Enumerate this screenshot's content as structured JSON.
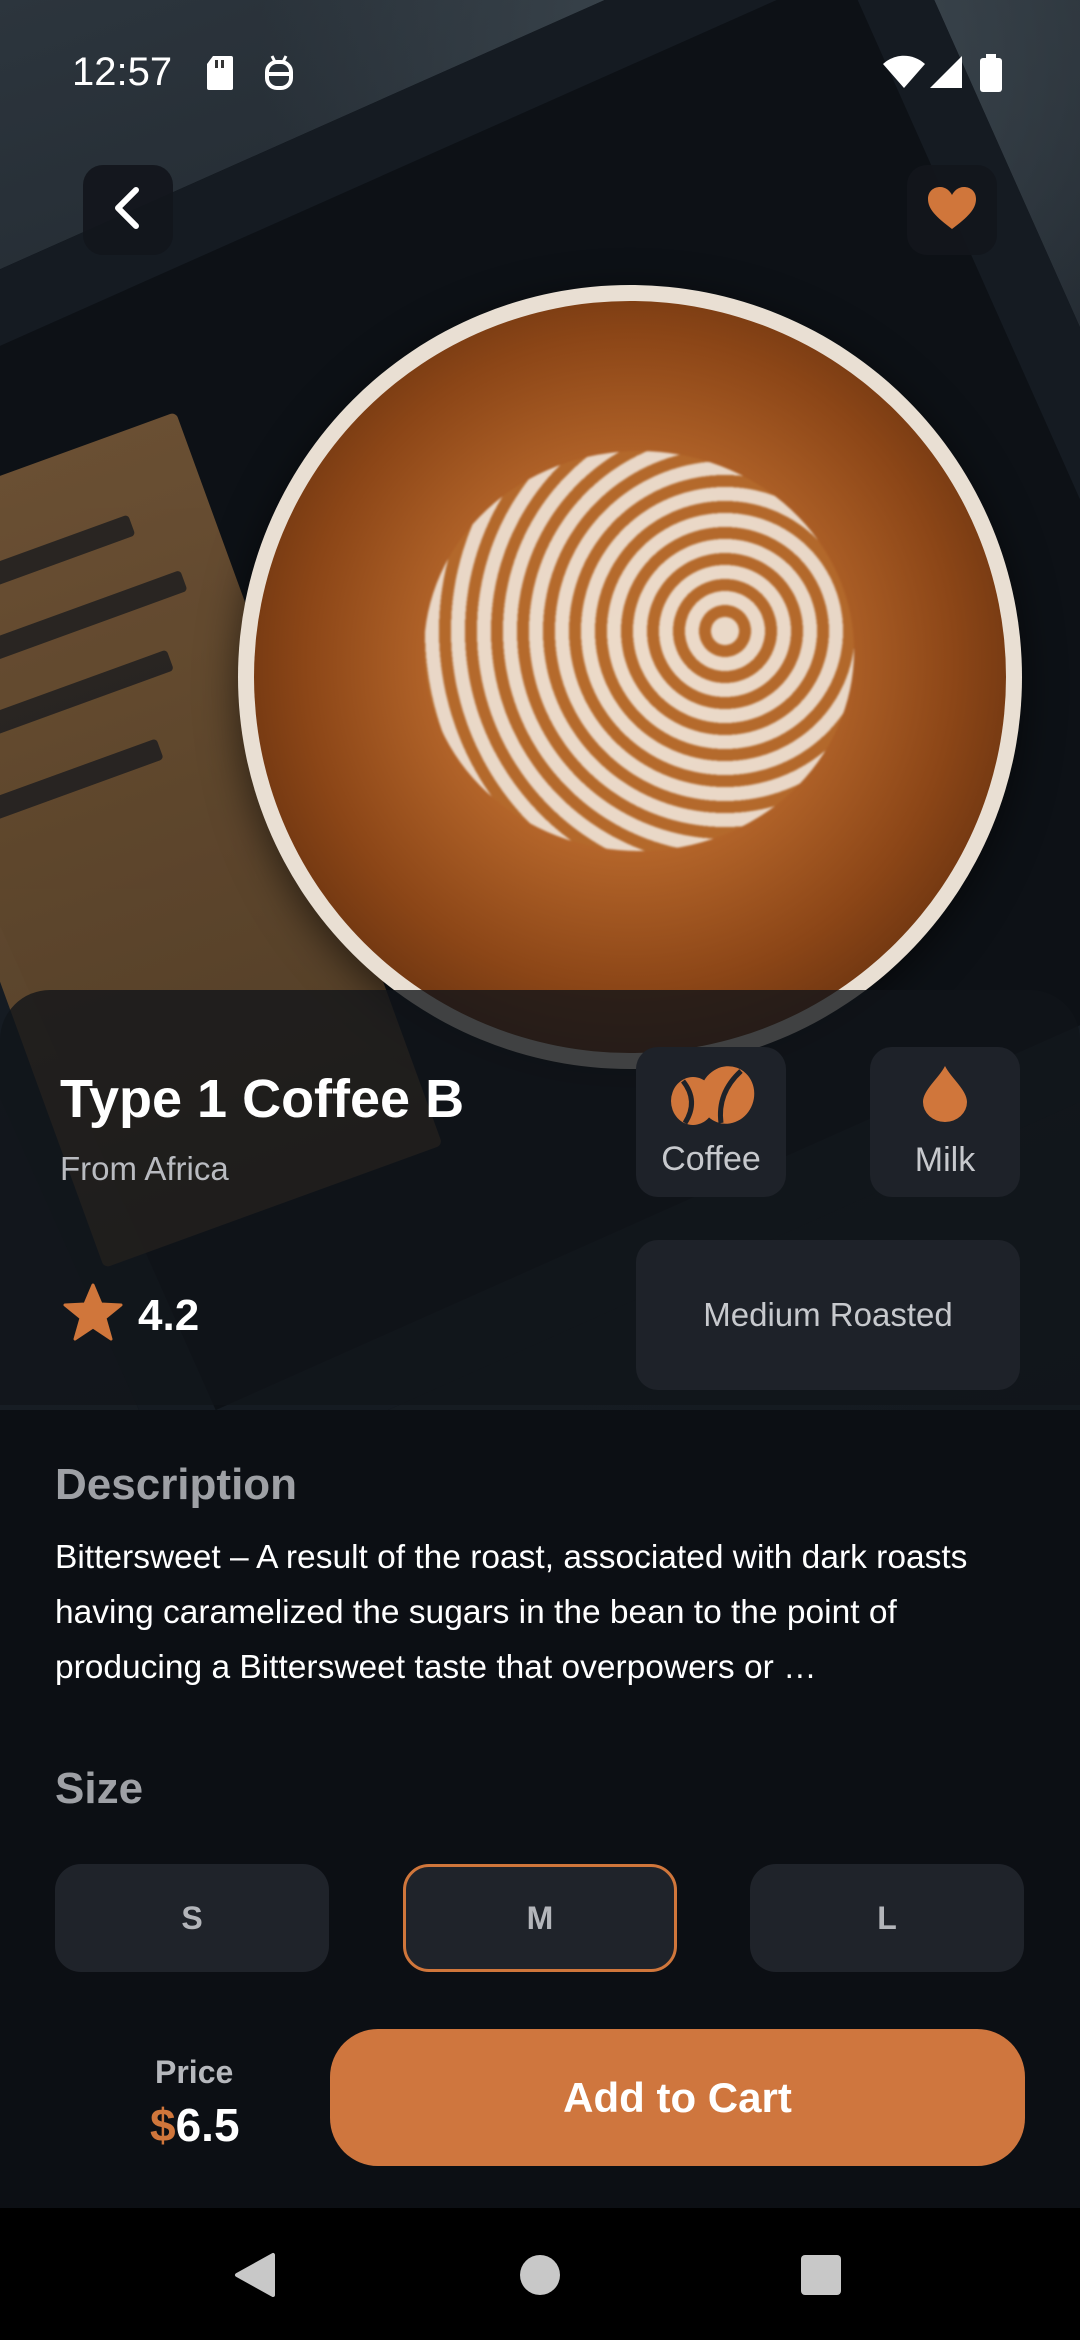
{
  "status_bar": {
    "time": "12:57",
    "icons": [
      "sd-card-icon",
      "bug-icon",
      "wifi-icon",
      "signal-icon",
      "battery-icon"
    ]
  },
  "header": {
    "back_icon": "chevron-left-icon",
    "favorite_icon": "heart-icon"
  },
  "product": {
    "name": "Type 1 Coffee B",
    "origin": "From Africa",
    "rating": "4.2",
    "chips": {
      "coffee": {
        "label": "Coffee",
        "icon": "coffee-bean-icon"
      },
      "milk": {
        "label": "Milk",
        "icon": "milk-drop-icon"
      },
      "roast": "Medium Roasted"
    }
  },
  "description": {
    "heading": "Description",
    "text": "Bittersweet – A result of the roast, associated with dark roasts having caramelized the sugars in the bean to the point of producing a Bittersweet taste that overpowers or …"
  },
  "size": {
    "heading": "Size",
    "options": [
      "S",
      "M",
      "L"
    ],
    "selected": "M"
  },
  "footer": {
    "price_label": "Price",
    "currency": "$",
    "price": "6.5",
    "cart_label": "Add to Cart"
  },
  "colors": {
    "accent": "#cf763e",
    "background": "#0c0f14",
    "chip": "#1e2229"
  }
}
